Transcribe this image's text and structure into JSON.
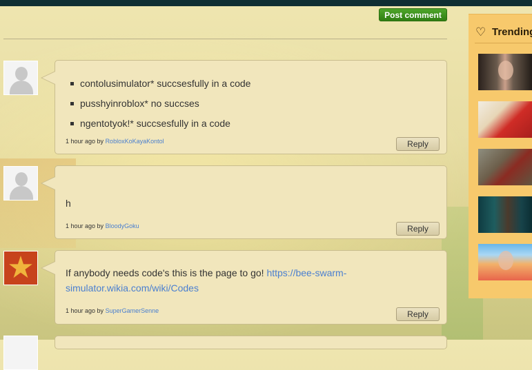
{
  "toolbar": {
    "post_comment_label": "Post comment"
  },
  "comments": [
    {
      "bullets": [
        "contolusimulator* succsesfully in a code",
        "pusshyinroblox* no succses",
        "ngentotyok!* succsesfully in a code"
      ],
      "time": "1 hour ago by",
      "user": "RobloxKoKayaKontol",
      "reply_label": "Reply"
    },
    {
      "text": "h",
      "time": "1 hour ago by",
      "user": "BloodyGoku",
      "reply_label": "Reply"
    },
    {
      "text": "If anybody needs code's this is the page to go!",
      "link": "https://bee-swarm-simulator.wikia.com/wiki/Codes",
      "time": "1 hour ago by",
      "user": "SuperGamerSenne",
      "reply_label": "Reply"
    }
  ],
  "trending": {
    "title": "Trending",
    "icon": "heart-icon",
    "items": [
      "video-thumb",
      "video-thumb",
      "video-thumb",
      "video-thumb",
      "video-thumb"
    ]
  },
  "colors": {
    "accent_green": "#3a8f1a",
    "link_blue": "#4a7fd0",
    "topbar": "#0f2f33",
    "trending_bg": "#f7c96c"
  }
}
